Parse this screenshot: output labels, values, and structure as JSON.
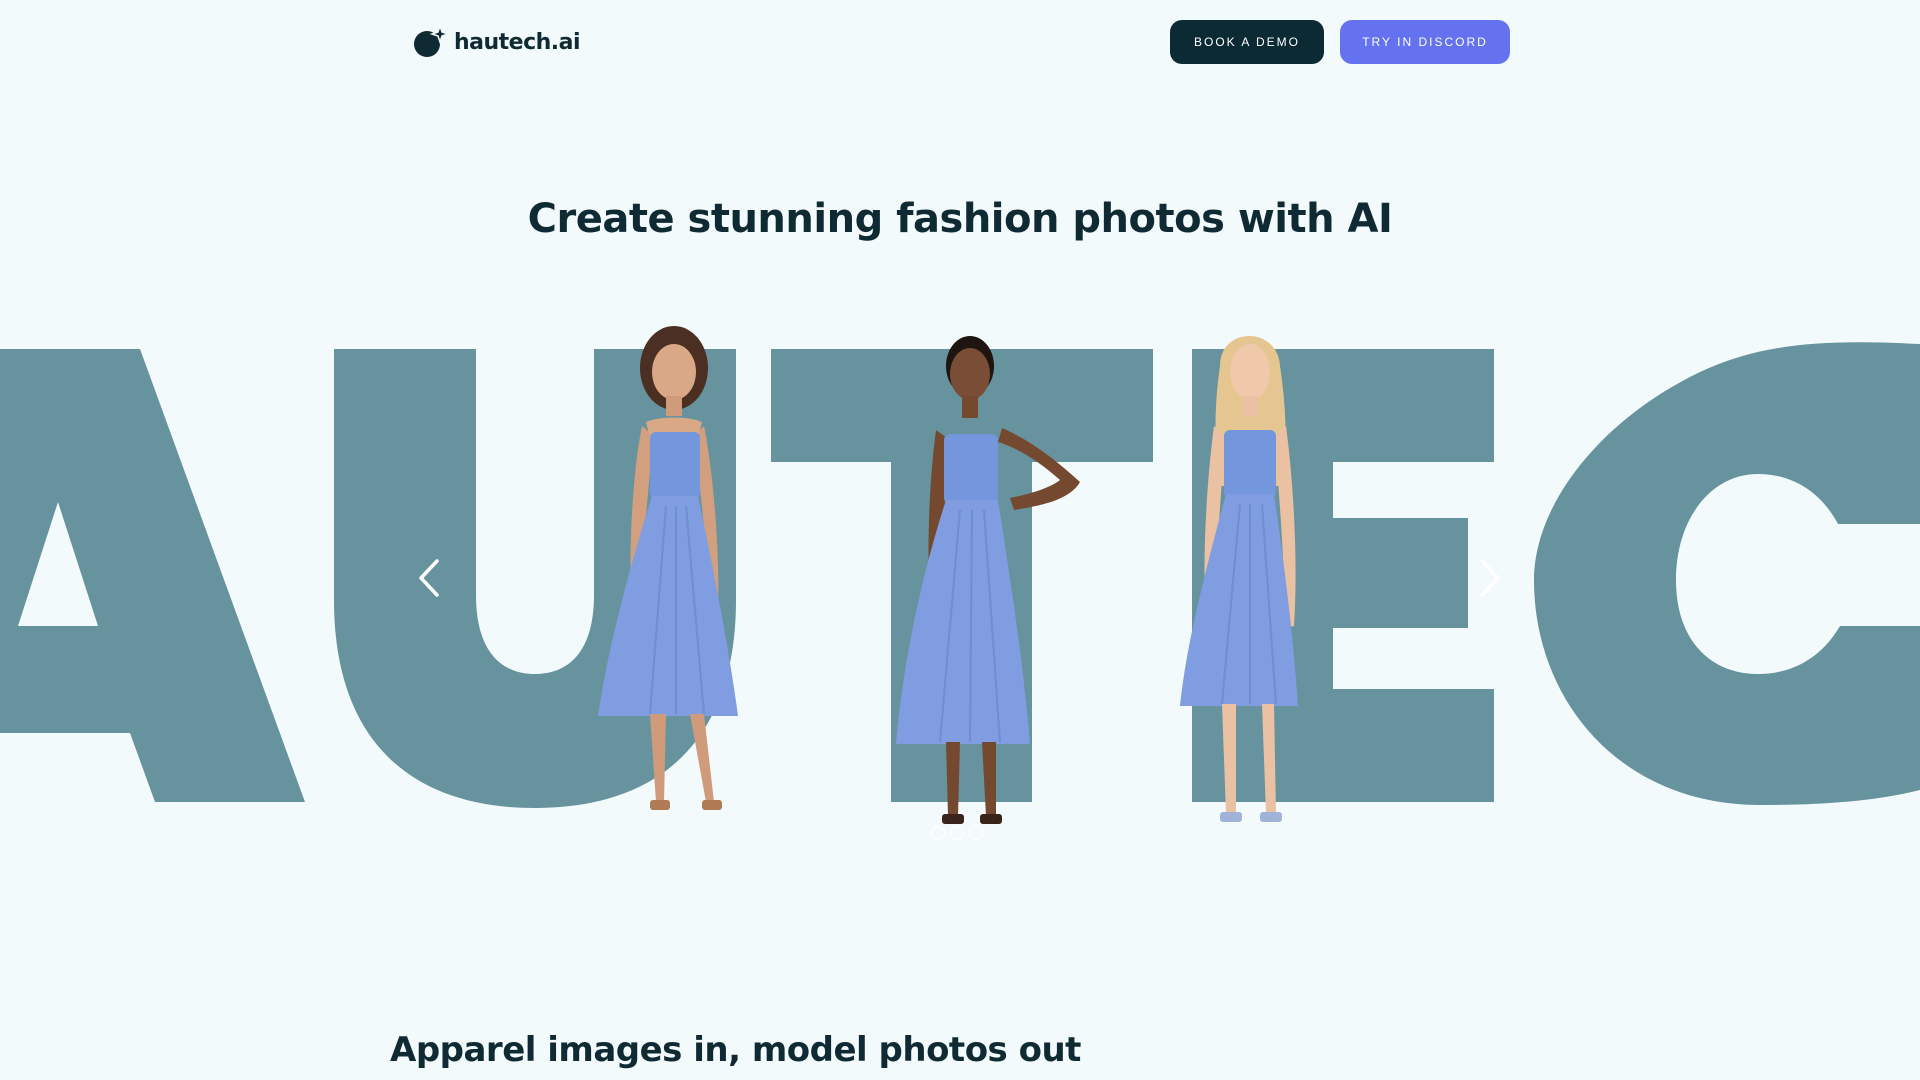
{
  "header": {
    "logo_text": "hautech.ai",
    "book_demo_label": "BOOK A DEMO",
    "discord_label": "TRY IN DISCORD"
  },
  "hero": {
    "title": "Create stunning fashion photos with AI",
    "backdrop_text": "AUTEC"
  },
  "carousel": {
    "models": [
      {
        "name": "model-curly-brunette"
      },
      {
        "name": "model-dark-hair-hand-on-hip"
      },
      {
        "name": "model-blonde-wavy"
      }
    ],
    "slide_count": 3
  },
  "section": {
    "title": "Apparel images in, model photos out"
  },
  "colors": {
    "background": "#f3fafc",
    "backdrop_letters": "#66939d",
    "dress": "#7f9de0",
    "demo_button": "#0b2a33",
    "discord_button": "#6472f0",
    "text": "#0f2a33"
  }
}
